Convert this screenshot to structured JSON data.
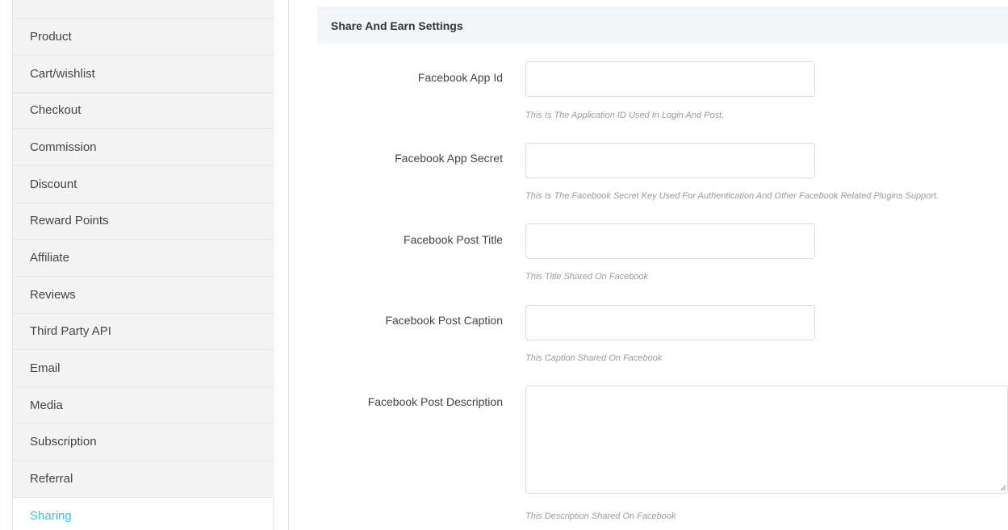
{
  "sidebar": {
    "items": [
      {
        "label": "Product"
      },
      {
        "label": "Cart/wishlist"
      },
      {
        "label": "Checkout"
      },
      {
        "label": "Commission"
      },
      {
        "label": "Discount"
      },
      {
        "label": "Reward Points"
      },
      {
        "label": "Affiliate"
      },
      {
        "label": "Reviews"
      },
      {
        "label": "Third Party API"
      },
      {
        "label": "Email"
      },
      {
        "label": "Media"
      },
      {
        "label": "Subscription"
      },
      {
        "label": "Referral"
      },
      {
        "label": "Sharing"
      }
    ],
    "active_item": "Sharing",
    "active_color": "#3ec1e8"
  },
  "section": {
    "title": "Share And Earn Settings"
  },
  "fields": {
    "app_id": {
      "label": "Facebook App Id",
      "value": "",
      "help": "This Is The Application ID Used In Login And Post."
    },
    "app_secret": {
      "label": "Facebook App Secret",
      "value": "",
      "help": "This Is The Facebook Secret Key Used For Authentication And Other Facebook Related Plugins Support."
    },
    "post_title": {
      "label": "Facebook Post Title",
      "value": "",
      "help": "This Title Shared On Facebook"
    },
    "post_caption": {
      "label": "Facebook Post Caption",
      "value": "",
      "help": "This Caption Shared On Facebook"
    },
    "post_description": {
      "label": "Facebook Post Description",
      "value": "",
      "help": "This Description Shared On Facebook"
    }
  }
}
